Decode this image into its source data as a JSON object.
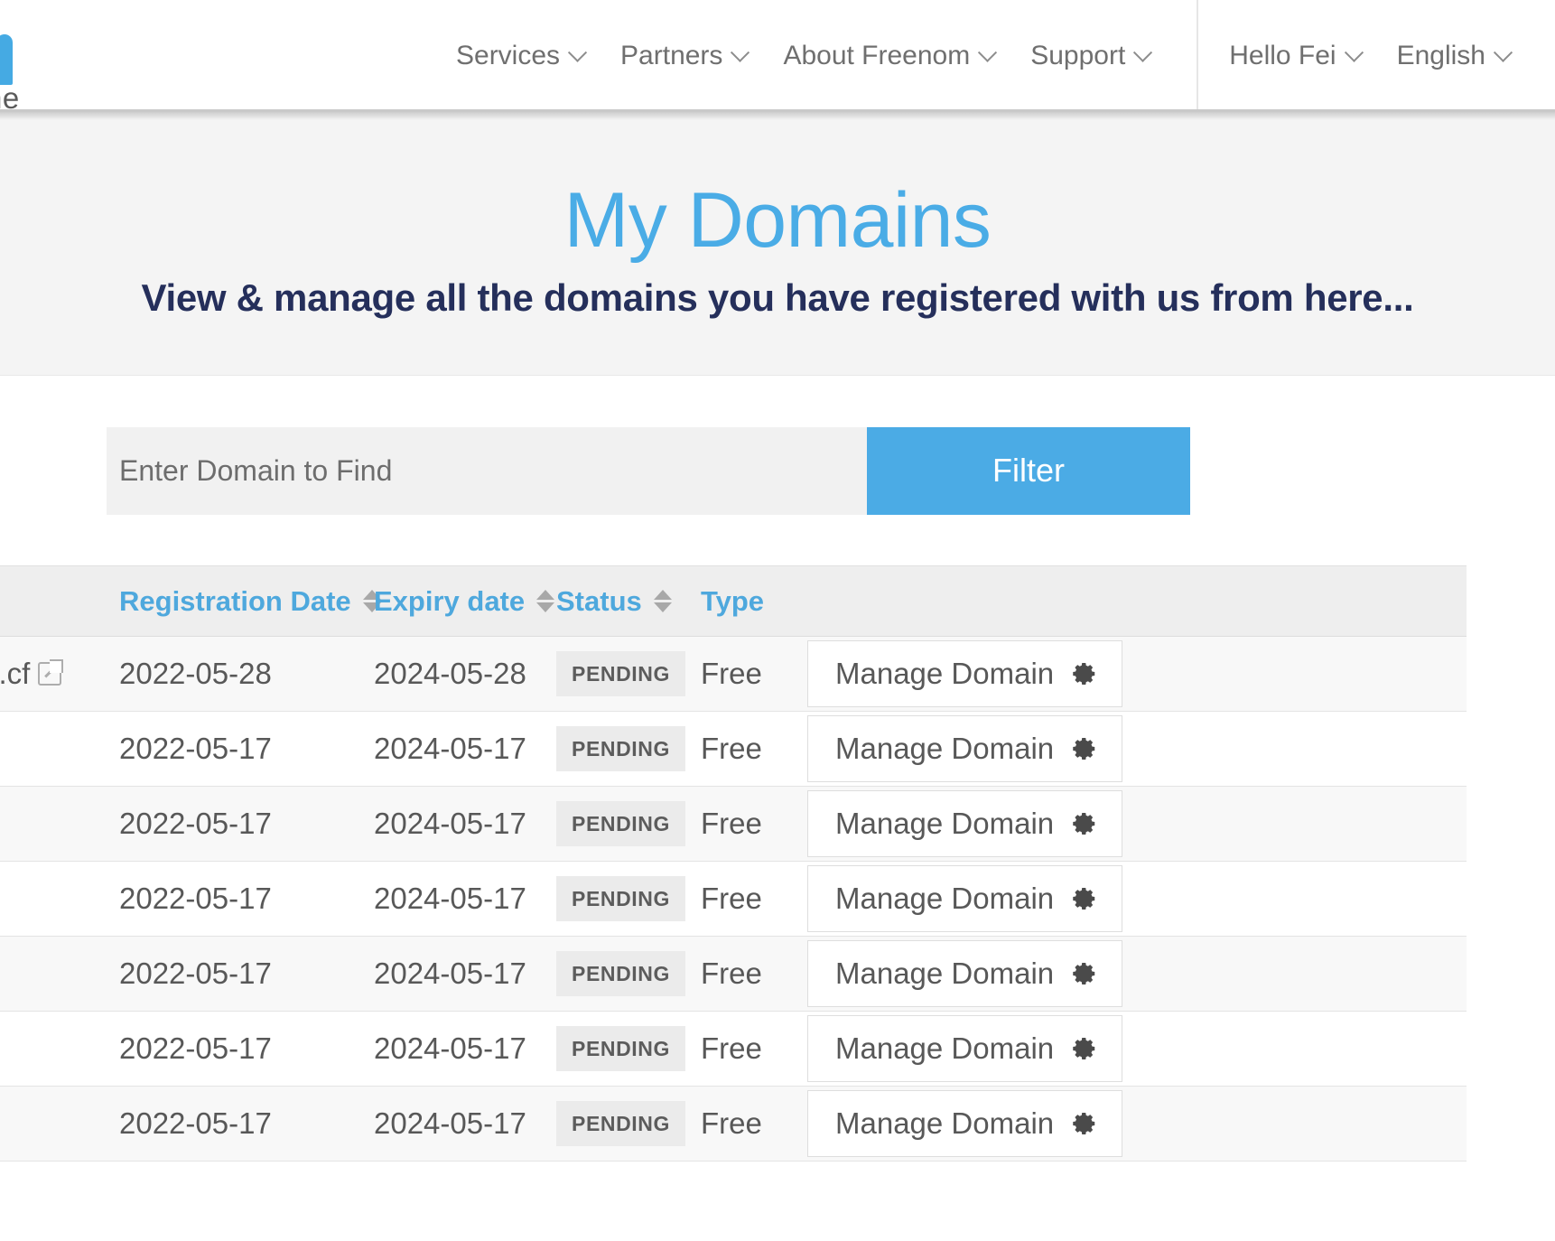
{
  "header": {
    "logo": {
      "word": "ne",
      "mark_color": "#45AAE3"
    },
    "nav": [
      {
        "label": "Services",
        "icon": "chevron-down-icon"
      },
      {
        "label": "Partners",
        "icon": "chevron-down-icon"
      },
      {
        "label": "About Freenom",
        "icon": "chevron-down-icon"
      },
      {
        "label": "Support",
        "icon": "chevron-down-icon"
      }
    ],
    "user": [
      {
        "label": "Hello Fei",
        "icon": "chevron-down-icon"
      },
      {
        "label": "English",
        "icon": "chevron-down-icon"
      }
    ]
  },
  "hero": {
    "title": "My Domains",
    "title_color": "#4AACE6",
    "subtitle": "View & manage all the domains you have registered with us from here...",
    "subtitle_color": "#252f5b"
  },
  "filter": {
    "placeholder": "Enter Domain to Find",
    "value": "",
    "button_label": "Filter",
    "button_color": "#4BABE5"
  },
  "table": {
    "columns": [
      {
        "key": "domain",
        "label": "",
        "sortable": false
      },
      {
        "key": "registration_date",
        "label": "Registration Date",
        "sortable": true
      },
      {
        "key": "expiry_date",
        "label": "Expiry date",
        "sortable": true
      },
      {
        "key": "status",
        "label": "Status",
        "sortable": true
      },
      {
        "key": "type",
        "label": "Type",
        "sortable": false
      },
      {
        "key": "action",
        "label": "",
        "sortable": false
      }
    ],
    "header_color": "#4EA8DD",
    "manage_label": "Manage Domain",
    "manage_icon": "gear-icon",
    "rows": [
      {
        "domain": "s.cf",
        "domain_icon": "external-link-icon",
        "registration_date": "2022-05-28",
        "expiry_date": "2024-05-28",
        "status": "PENDING",
        "type": "Free",
        "action": "Manage Domain"
      },
      {
        "domain": "",
        "domain_icon": "external-link-icon",
        "registration_date": "2022-05-17",
        "expiry_date": "2024-05-17",
        "status": "PENDING",
        "type": "Free",
        "action": "Manage Domain"
      },
      {
        "domain": "",
        "domain_icon": "",
        "registration_date": "2022-05-17",
        "expiry_date": "2024-05-17",
        "status": "PENDING",
        "type": "Free",
        "action": "Manage Domain"
      },
      {
        "domain": "",
        "domain_icon": "",
        "registration_date": "2022-05-17",
        "expiry_date": "2024-05-17",
        "status": "PENDING",
        "type": "Free",
        "action": "Manage Domain"
      },
      {
        "domain": "",
        "domain_icon": "",
        "registration_date": "2022-05-17",
        "expiry_date": "2024-05-17",
        "status": "PENDING",
        "type": "Free",
        "action": "Manage Domain"
      },
      {
        "domain": "",
        "domain_icon": "",
        "registration_date": "2022-05-17",
        "expiry_date": "2024-05-17",
        "status": "PENDING",
        "type": "Free",
        "action": "Manage Domain"
      },
      {
        "domain": "",
        "domain_icon": "",
        "registration_date": "2022-05-17",
        "expiry_date": "2024-05-17",
        "status": "PENDING",
        "type": "Free",
        "action": "Manage Domain"
      }
    ]
  }
}
